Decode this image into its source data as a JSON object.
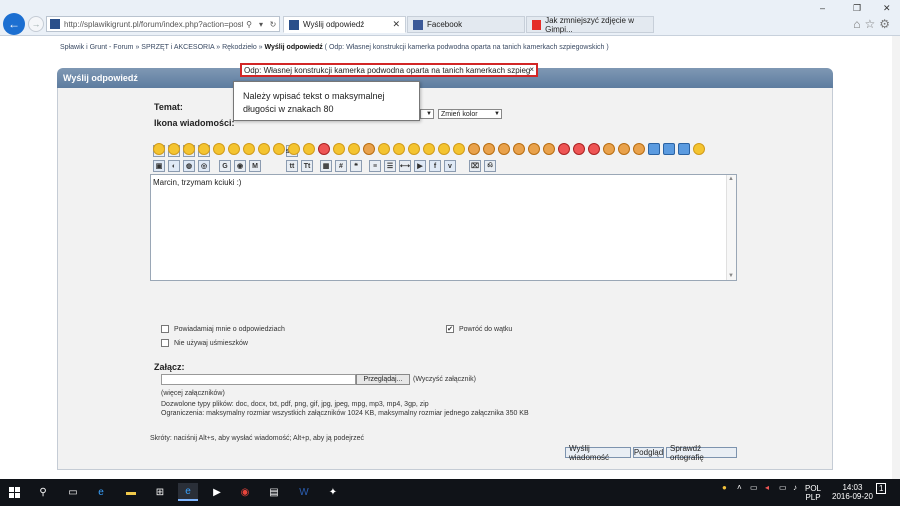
{
  "browser": {
    "url": "http://splawikigrunt.pl/forum/index.php?action=post;topic=52",
    "tabs": [
      {
        "label": "Wyślij odpowiedź"
      },
      {
        "label": "Facebook"
      },
      {
        "label": "Jak zmniejszyć zdjęcie w Gimpi..."
      }
    ],
    "window_controls": {
      "minimize": "–",
      "restore": "❐",
      "close": "✕"
    }
  },
  "breadcrumb": {
    "path": "Spławik i Grunt - Forum » SPRZĘT i AKCESORIA » Rękodzieło » ",
    "current": "Wyślij odpowiedź",
    "suffix": " ( Odp: Własnej konstrukcji kamerka podwodna oparta na tanich kamerkach szpiegowskich )"
  },
  "panel": {
    "title": "Wyślij odpowiedź"
  },
  "form": {
    "subject_label": "Temat:",
    "subject_value": "Odp: Własnej konstrukcji kamerka podwodna oparta na tanich kamerkach szpieg",
    "subject_clear": "×",
    "icon_label": "Ikona wiadomości:",
    "tooltip": "Należy wpisać tekst o maksymalnej długości w znakach 80",
    "color_select": "Zmień kolor",
    "message": "Marcin, trzymam kciuki :)",
    "options": {
      "notify": "Powiadamiaj mnie o odpowiedziach",
      "no_smileys": "Nie używaj uśmieszków",
      "return": "Powróć do wątku"
    },
    "attach_label": "Załącz:",
    "browse": "Przeglądaj...",
    "clear_attach": "(Wyczyść załącznik)",
    "more_attach": "(więcej załączników)",
    "allowed_types": "Dozwolone typy plików: doc, docx, txt, pdf, png, gif, jpg, jpeg, mpg, mp3, mp4, 3gp, zip",
    "limits": "Ograniczenia: maksymalny rozmiar wszystkich załączników 1024 KB, maksymalny rozmiar jednego załącznika 350 KB",
    "shortcuts": "Skróty: naciśnij Alt+s, aby wysłać wiadomość; Alt+p, aby ją podejrzeć",
    "buttons": {
      "send": "Wyślij wiadomość",
      "preview": "Podgląd",
      "spellcheck": "Sprawdź ortografię"
    }
  },
  "taskbar": {
    "language": "POL",
    "layout": "PLP",
    "time": "14:03",
    "date": "2016-09-20",
    "notifications": "1"
  },
  "colors": {
    "accent_blue": "#1c6fd1",
    "panel_header": "#6a87a8",
    "highlight_border": "#d22626",
    "taskbar": "#101318"
  }
}
